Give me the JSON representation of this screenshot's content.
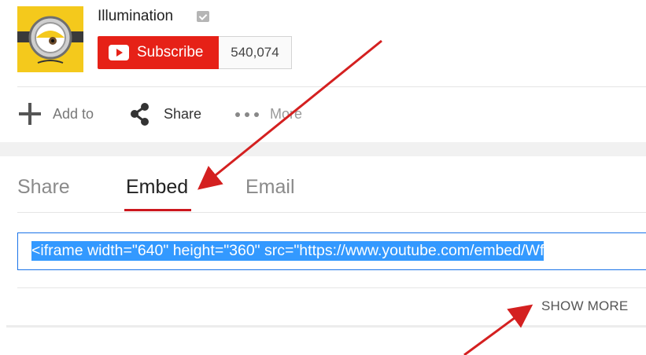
{
  "channel": {
    "name": "Illumination",
    "subscribe_label": "Subscribe",
    "subscriber_count": "540,074"
  },
  "actions": {
    "add_to": "Add to",
    "share": "Share",
    "more": "More"
  },
  "tabs": {
    "share": "Share",
    "embed": "Embed",
    "email": "Email",
    "active": "Embed"
  },
  "embed": {
    "code": "<iframe width=\"640\" height=\"360\" src=\"https://www.youtube.com/embed/Wf"
  },
  "show_more_label": "SHOW MORE",
  "colors": {
    "subscribe_red": "#e62117",
    "tab_underline": "#cc181e",
    "arrow": "#d42020",
    "selection_blue": "#3399ff"
  },
  "icons": [
    "verified-icon",
    "youtube-play-icon",
    "plus-icon",
    "share-icon",
    "more-dots-icon"
  ]
}
